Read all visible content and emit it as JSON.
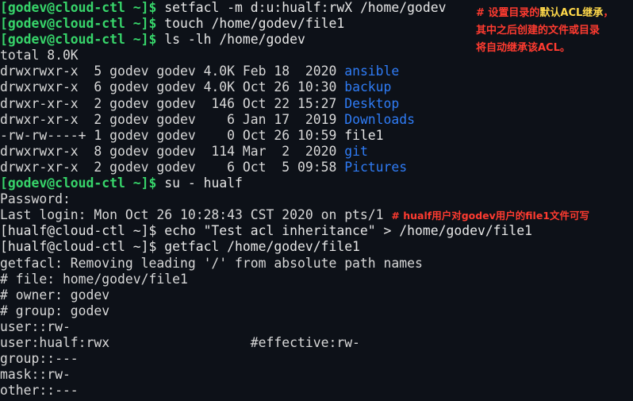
{
  "terminal": {
    "lines": [
      {
        "kind": "prompt",
        "prompt": "[godev@cloud-ctl ~]$",
        "command": " setfacl -m d:u:hualf:rwX /home/godev"
      },
      {
        "kind": "prompt",
        "prompt": "[godev@cloud-ctl ~]$",
        "command": " touch /home/godev/file1"
      },
      {
        "kind": "prompt",
        "prompt": "[godev@cloud-ctl ~]$",
        "command": " ls -lh /home/godev"
      },
      {
        "kind": "text",
        "text": "total 8.0K"
      },
      {
        "kind": "ls",
        "meta": "drwxrwxr-x  5 godev godev 4.0K Feb 18  2020 ",
        "name": "ansible",
        "is_dir": true
      },
      {
        "kind": "ls",
        "meta": "drwxrwxr-x  6 godev godev 4.0K Oct 26 10:30 ",
        "name": "backup",
        "is_dir": true
      },
      {
        "kind": "ls",
        "meta": "drwxr-xr-x  2 godev godev  146 Oct 22 15:27 ",
        "name": "Desktop",
        "is_dir": true
      },
      {
        "kind": "ls",
        "meta": "drwxr-xr-x  2 godev godev    6 Jan 17  2019 ",
        "name": "Downloads",
        "is_dir": true
      },
      {
        "kind": "ls",
        "meta": "-rw-rw----+ 1 godev godev    0 Oct 26 10:59 ",
        "name": "file1",
        "is_dir": false
      },
      {
        "kind": "ls",
        "meta": "drwxrwxr-x  8 godev godev  114 Mar  2  2020 ",
        "name": "git",
        "is_dir": true
      },
      {
        "kind": "ls",
        "meta": "drwxr-xr-x  2 godev godev    6 Oct  5 09:58 ",
        "name": "Pictures",
        "is_dir": true
      },
      {
        "kind": "prompt",
        "prompt": "[godev@cloud-ctl ~]$",
        "command": " su - hualf"
      },
      {
        "kind": "text",
        "text": "Password:"
      },
      {
        "kind": "text_note",
        "text": "Last login: Mon Oct 26 10:28:43 CST 2020 on pts/1 ",
        "note": "# hualf用户对godev用户的file1文件可写"
      },
      {
        "kind": "plain_prompt",
        "text": "[hualf@cloud-ctl ~]$ echo \"Test acl inheritance\" > /home/godev/file1"
      },
      {
        "kind": "plain_prompt",
        "text": "[hualf@cloud-ctl ~]$ getfacl /home/godev/file1"
      },
      {
        "kind": "text",
        "text": "getfacl: Removing leading '/' from absolute path names"
      },
      {
        "kind": "text",
        "text": "# file: home/godev/file1"
      },
      {
        "kind": "text",
        "text": "# owner: godev"
      },
      {
        "kind": "text",
        "text": "# group: godev"
      },
      {
        "kind": "text",
        "text": "user::rw-"
      },
      {
        "kind": "text",
        "text": "user:hualf:rwx                  #effective:rw-"
      },
      {
        "kind": "text",
        "text": "group::---"
      },
      {
        "kind": "text",
        "text": "mask::rw-"
      },
      {
        "kind": "text",
        "text": "other::---"
      }
    ]
  },
  "annotation": {
    "line1_prefix": "# 设置目录的",
    "line1_highlight": "默认ACL继承",
    "line1_suffix": "，",
    "line2": "其中之后创建的文件或目录",
    "line3": "将自动继承该ACL。"
  },
  "colors": {
    "background": "#0d1118",
    "prompt": "#37d46a",
    "directory": "#2f7cf6",
    "annotation": "#ff3b30",
    "annotation_highlight": "#ffd84a"
  }
}
